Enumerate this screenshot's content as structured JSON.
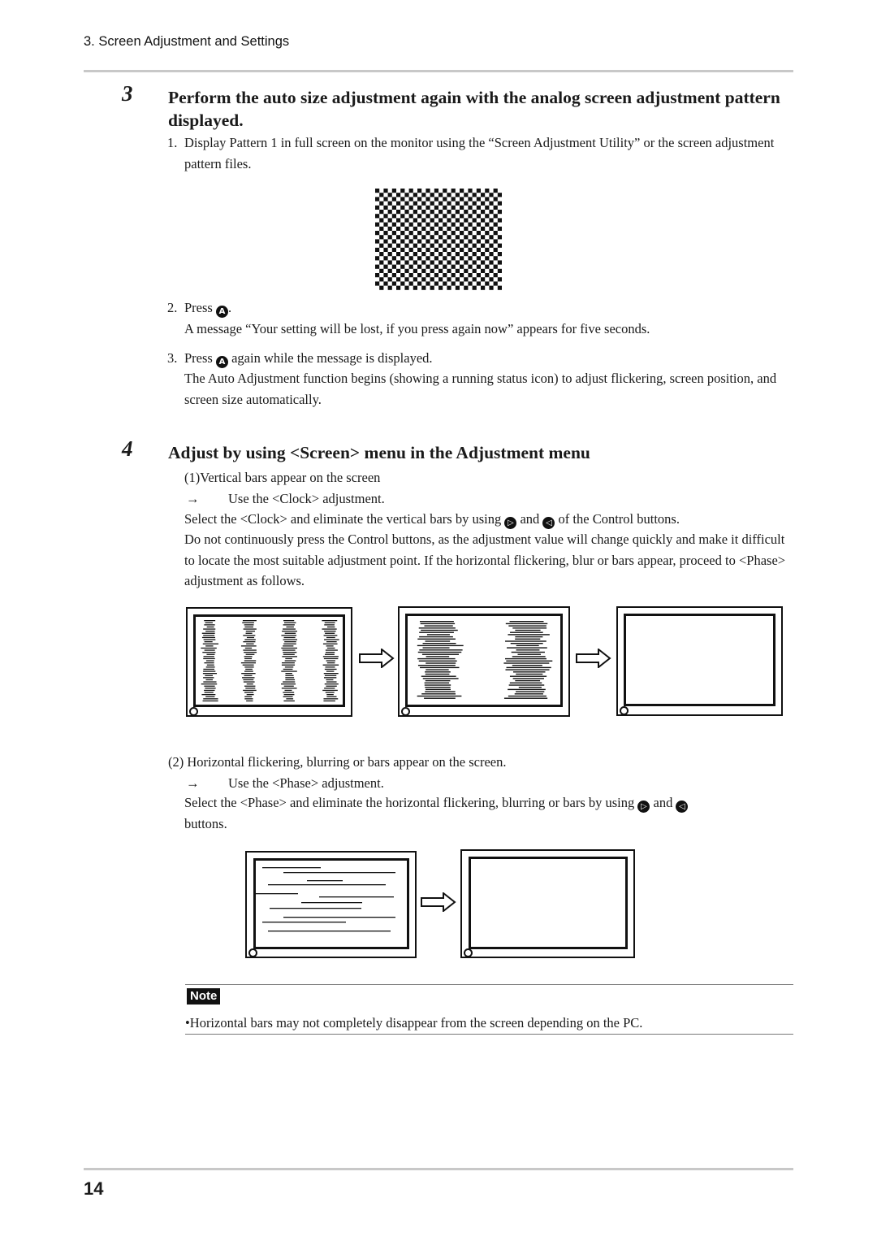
{
  "header": {
    "section_title": "3. Screen Adjustment and Settings"
  },
  "step3": {
    "number": "3",
    "title": "Perform the auto size adjustment again with the analog screen adjustment pattern displayed.",
    "item1": {
      "label": "1.",
      "text": "Display Pattern 1 in full screen on the monitor using the “Screen Adjustment Utility” or the screen adjustment pattern files."
    },
    "pattern_image": "checkerboard-pattern-1",
    "item2": {
      "label": "2.",
      "prefix": "Press",
      "button_icon": "auto-button-icon",
      "button_glyph": "A",
      "suffix": ".",
      "detail": "A message “Your setting will be lost, if you press again now” appears for five seconds."
    },
    "item3": {
      "label": "3.",
      "prefix": "Press",
      "button_icon": "auto-button-icon",
      "button_glyph": "A",
      "suffix": "again while the message is displayed.",
      "detail": "The Auto Adjustment function begins (showing a running status icon) to adjust flickering, screen position, and screen size automatically."
    }
  },
  "step4": {
    "number": "4",
    "title": "Adjust by using <Screen> menu in the Adjustment menu",
    "clock": {
      "condition": "(1)Vertical bars appear on the screen",
      "arrow": "→",
      "action": "Use the <Clock> adjustment.",
      "line1_prefix": "Select the <Clock> and eliminate the vertical bars by using",
      "right_button_glyph": "▷",
      "and": "and",
      "left_button_glyph": "◁",
      "line1_suffix": "of the Control buttons.",
      "detail": "Do not continuously press the Control buttons, as the adjustment value will change quickly and make it difficult to locate the most suitable adjustment point. If the horizontal flickering, blur or bars appear, proceed to <Phase> adjustment as follows.",
      "illustrations": [
        "monitor-vertical-bars",
        "monitor-two-bar-groups",
        "monitor-clear"
      ]
    },
    "phase": {
      "condition": "(2) Horizontal flickering, blurring or bars appear on the screen.",
      "arrow": "→",
      "action": "Use the <Phase> adjustment.",
      "line1_prefix": "Select the <Phase> and eliminate the horizontal flickering, blurring or bars by using",
      "right_button_glyph": "▷",
      "and": "and",
      "left_button_glyph": "◁",
      "line1_suffix": "buttons.",
      "illustrations": [
        "monitor-horizontal-lines",
        "monitor-clear"
      ]
    }
  },
  "note": {
    "badge": "Note",
    "text": "•Horizontal bars may not completely disappear from the screen depending on the PC."
  },
  "footer": {
    "page_number": "14"
  }
}
